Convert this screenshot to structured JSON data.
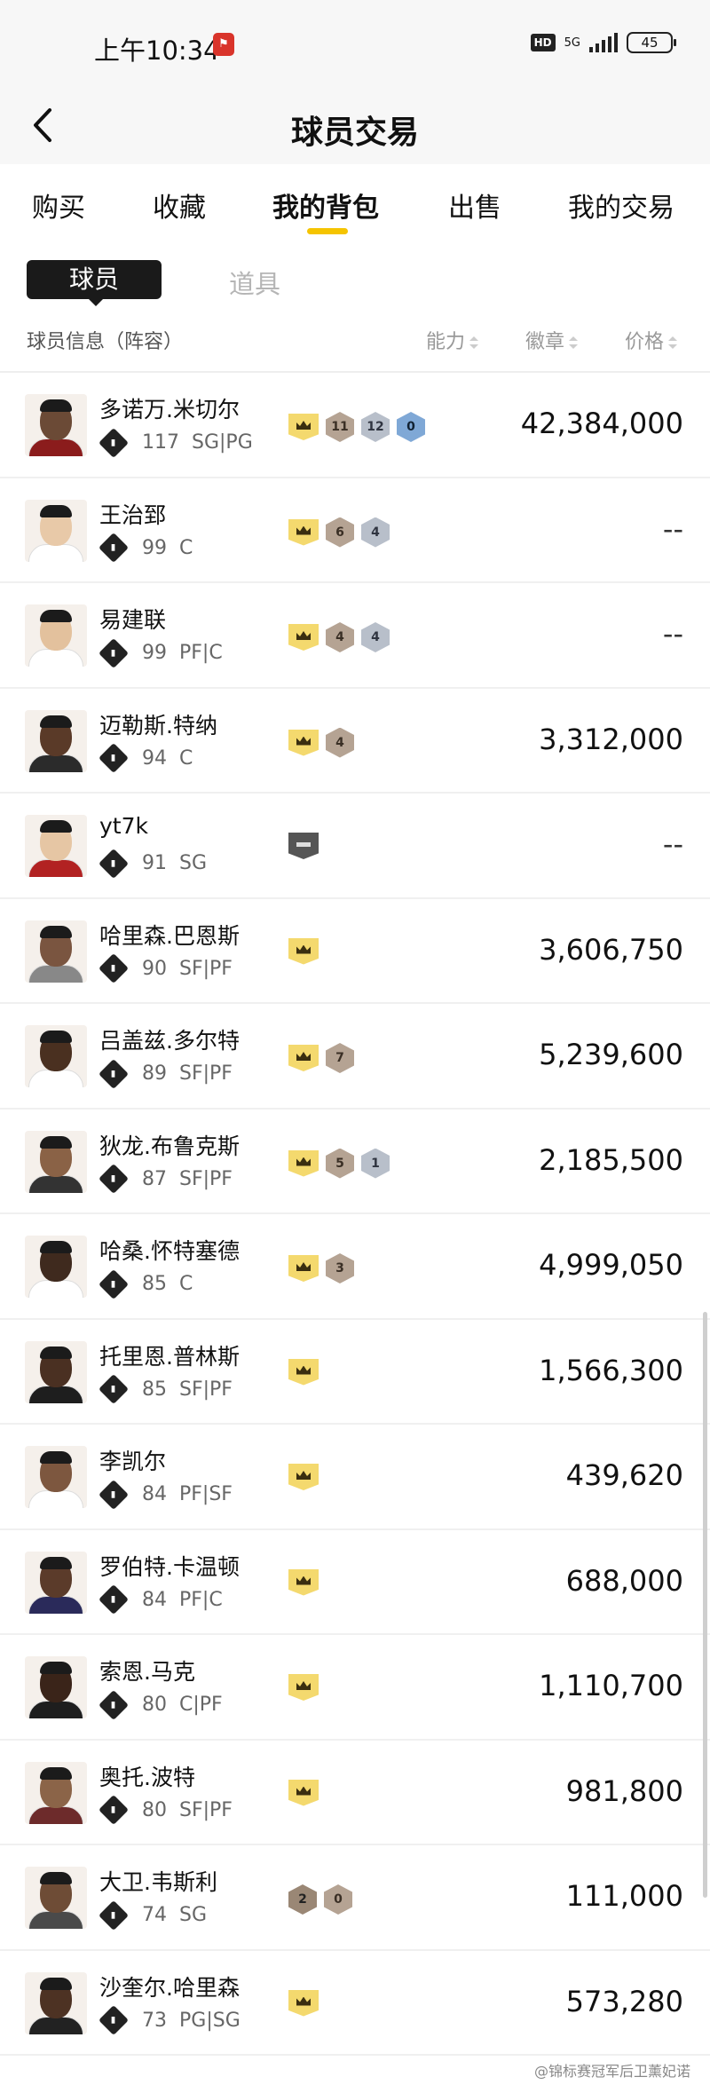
{
  "status_bar": {
    "time": "上午10:34",
    "notif_badge": "🎏",
    "hd": "HD",
    "network": "5G",
    "battery": "45"
  },
  "nav": {
    "title": "球员交易"
  },
  "tabs": [
    {
      "label": "购买"
    },
    {
      "label": "收藏"
    },
    {
      "label": "我的背包"
    },
    {
      "label": "出售"
    },
    {
      "label": "我的交易"
    }
  ],
  "subtabs": {
    "active": "球员",
    "other": "道具"
  },
  "columns": {
    "info": "球员信息（阵容）",
    "ability": "能力",
    "badge": "徽章",
    "price": "价格"
  },
  "players": [
    {
      "name": "多诺万.米切尔",
      "rating": "117",
      "pos": "SG|PG",
      "price": "42,384,000",
      "badges": [
        "crown",
        "11",
        "12",
        "0"
      ]
    },
    {
      "name": "王治郅",
      "rating": "99",
      "pos": "C",
      "price": "--",
      "badges": [
        "crown",
        "6",
        "4"
      ]
    },
    {
      "name": "易建联",
      "rating": "99",
      "pos": "PF|C",
      "price": "--",
      "badges": [
        "crown",
        "4",
        "4"
      ]
    },
    {
      "name": "迈勒斯.特纳",
      "rating": "94",
      "pos": "C",
      "price": "3,312,000",
      "badges": [
        "crown",
        "4"
      ]
    },
    {
      "name": "yt7k",
      "rating": "91",
      "pos": "SG",
      "price": "--",
      "badges": [
        "dark"
      ]
    },
    {
      "name": "哈里森.巴恩斯",
      "rating": "90",
      "pos": "SF|PF",
      "price": "3,606,750",
      "badges": [
        "crown"
      ]
    },
    {
      "name": "吕盖兹.多尔特",
      "rating": "89",
      "pos": "SF|PF",
      "price": "5,239,600",
      "badges": [
        "crown",
        "7"
      ]
    },
    {
      "name": "狄龙.布鲁克斯",
      "rating": "87",
      "pos": "SF|PF",
      "price": "2,185,500",
      "badges": [
        "crown",
        "5",
        "1"
      ]
    },
    {
      "name": "哈桑.怀特塞德",
      "rating": "85",
      "pos": "C",
      "price": "4,999,050",
      "badges": [
        "crown",
        "3"
      ]
    },
    {
      "name": "托里恩.普林斯",
      "rating": "85",
      "pos": "SF|PF",
      "price": "1,566,300",
      "badges": [
        "crown"
      ]
    },
    {
      "name": "李凯尔",
      "rating": "84",
      "pos": "PF|SF",
      "price": "439,620",
      "badges": [
        "crown"
      ]
    },
    {
      "name": "罗伯特.卡温顿",
      "rating": "84",
      "pos": "PF|C",
      "price": "688,000",
      "badges": [
        "crown"
      ]
    },
    {
      "name": "索恩.马克",
      "rating": "80",
      "pos": "C|PF",
      "price": "1,110,700",
      "badges": [
        "crown"
      ]
    },
    {
      "name": "奥托.波特",
      "rating": "80",
      "pos": "SF|PF",
      "price": "981,800",
      "badges": [
        "crown"
      ]
    },
    {
      "name": "大卫.韦斯利",
      "rating": "74",
      "pos": "SG",
      "price": "111,000",
      "badges": [
        "2",
        "0"
      ]
    },
    {
      "name": "沙奎尔.哈里森",
      "rating": "73",
      "pos": "PG|SG",
      "price": "573,280",
      "badges": [
        "crown"
      ]
    }
  ],
  "watermark": "@锦标赛冠军后卫薰妃诺"
}
